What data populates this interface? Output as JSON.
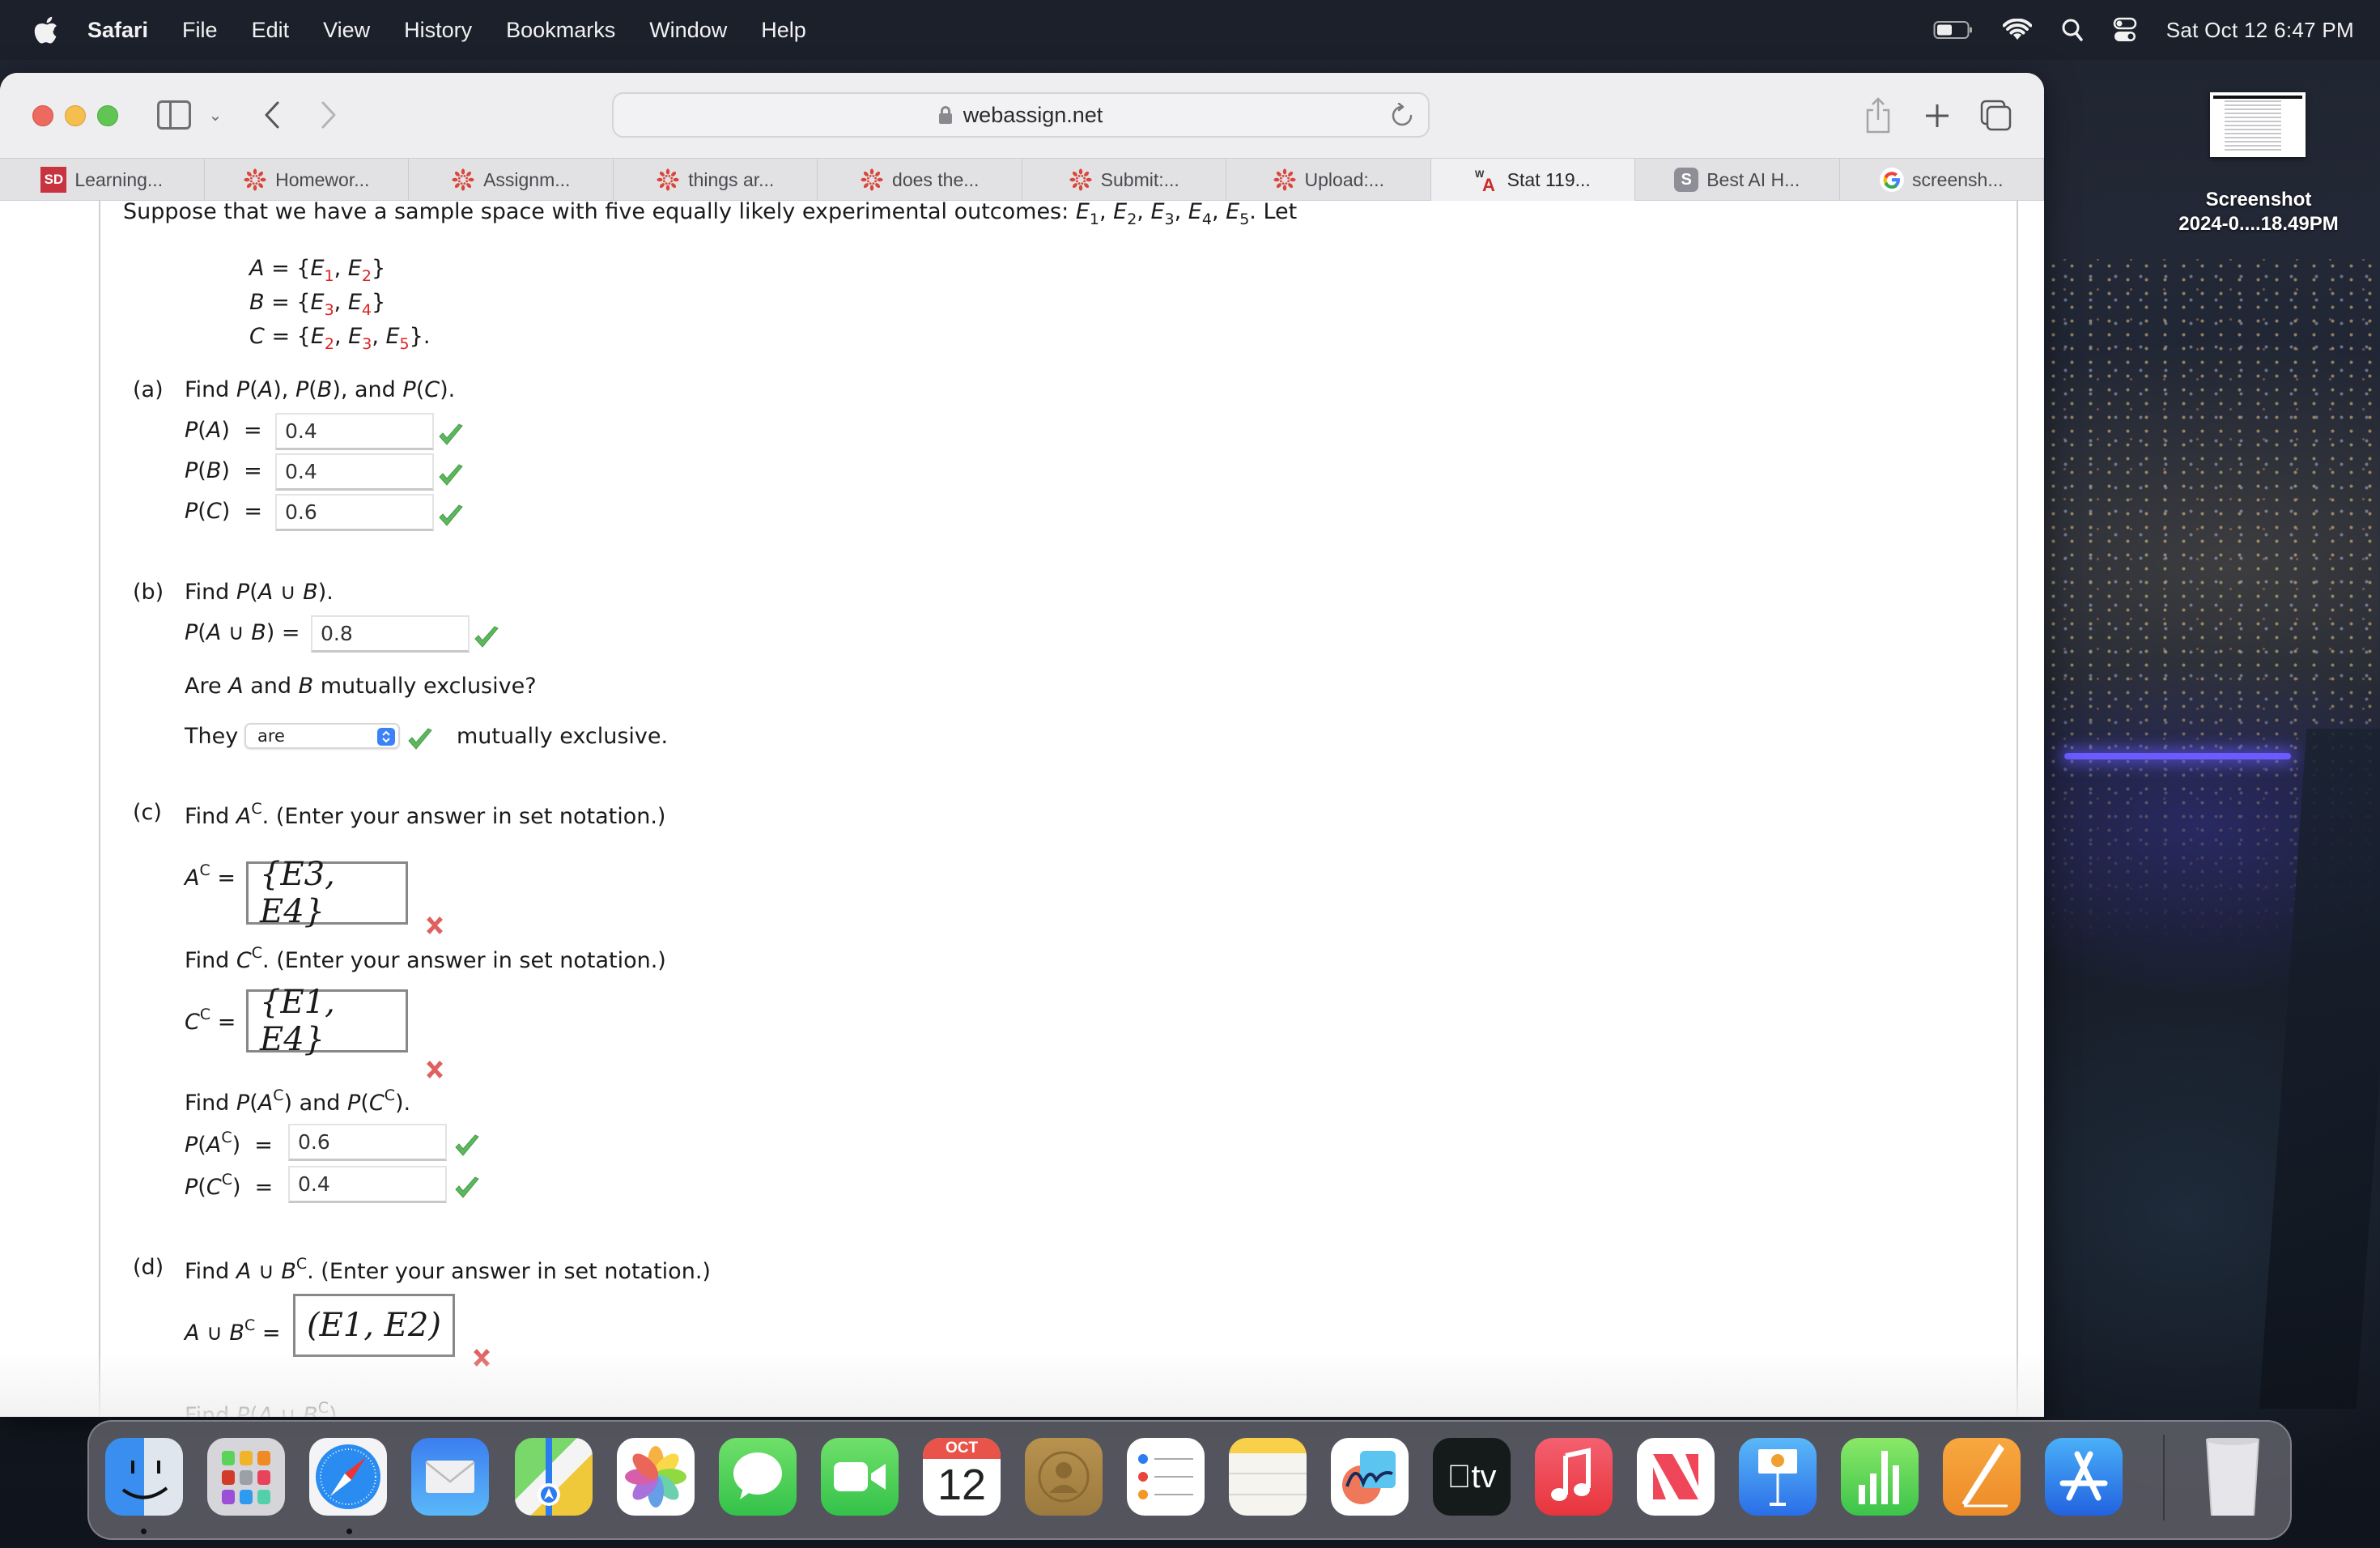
{
  "menubar": {
    "app_name": "Safari",
    "items": [
      "File",
      "Edit",
      "View",
      "History",
      "Bookmarks",
      "Window",
      "Help"
    ],
    "clock": "Sat Oct 12  6:47 PM",
    "status_icons": [
      "battery-icon",
      "wifi-icon",
      "spotlight-search-icon",
      "control-center-icon"
    ]
  },
  "browser": {
    "address": "webassign.net",
    "tabs": [
      {
        "label": "Learning...",
        "favicon": "SD",
        "active": false
      },
      {
        "label": "Homewor...",
        "favicon": "canvas",
        "active": false
      },
      {
        "label": "Assignm...",
        "favicon": "canvas",
        "active": false
      },
      {
        "label": "things ar...",
        "favicon": "canvas",
        "active": false
      },
      {
        "label": "does the...",
        "favicon": "canvas",
        "active": false
      },
      {
        "label": "Submit:...",
        "favicon": "canvas",
        "active": false
      },
      {
        "label": "Upload:...",
        "favicon": "canvas",
        "active": false
      },
      {
        "label": "Stat 119...",
        "favicon": "WA",
        "active": true
      },
      {
        "label": "Best AI H...",
        "favicon": "S",
        "active": false
      },
      {
        "label": "screensh...",
        "favicon": "G",
        "active": false
      }
    ]
  },
  "problem": {
    "intro": "Suppose that we have a sample space with five equally likely experimental outcomes: ",
    "intro_end": ". Let",
    "outcomes": [
      "1",
      "2",
      "3",
      "4",
      "5"
    ],
    "sets": [
      {
        "name": "A",
        "elements": [
          "1",
          "2"
        ],
        "end": ""
      },
      {
        "name": "B",
        "elements": [
          "3",
          "4"
        ],
        "end": ""
      },
      {
        "name": "C",
        "elements": [
          "2",
          "3",
          "5"
        ],
        "end": "."
      }
    ],
    "part_a": {
      "label": "(a)",
      "prompt": "Find P(A), P(B), and P(C).",
      "answers": [
        {
          "label": "P(A)",
          "value": "0.4",
          "status": "correct"
        },
        {
          "label": "P(B)",
          "value": "0.4",
          "status": "correct"
        },
        {
          "label": "P(C)",
          "value": "0.6",
          "status": "correct"
        }
      ]
    },
    "part_b": {
      "label": "(b)",
      "prompt": "Find P(A ∪ B).",
      "answer_label": "P(A ∪ B)",
      "answer_value": "0.8",
      "answer_status": "correct",
      "question": "Are A and B mutually exclusive?",
      "they": "They",
      "select_value": "are",
      "select_status": "correct",
      "suffix": "mutually exclusive."
    },
    "part_c": {
      "label": "(c)",
      "prompt_ac": "Find A",
      "prompt_suffix": ". (Enter your answer in set notation.)",
      "ac_label": "A",
      "ac_value": "{E3, E4}",
      "ac_status": "incorrect",
      "prompt_cc": "Find C",
      "cc_label": "C",
      "cc_value": "{E1, E4}",
      "cc_status": "incorrect",
      "prompt_probs": "Find P(A",
      "prob_answers": [
        {
          "label": "P(A",
          "value": "0.6",
          "status": "correct"
        },
        {
          "label": "P(C",
          "value": "0.4",
          "status": "correct"
        }
      ]
    },
    "part_d": {
      "label": "(d)",
      "prompt": "Find A ∪ B",
      "prompt_suffix": ". (Enter your answer in set notation.)",
      "answer_label": "A ∪ B",
      "answer_value": "(E1, E2)",
      "answer_status": "incorrect",
      "next_prompt": "Find P(A ∪ B"
    },
    "complement_sup": "C"
  },
  "desktop": {
    "file_name_line1": "Screenshot",
    "file_name_line2": "2024-0....18.49PM"
  },
  "dock": {
    "calendar_month": "OCT",
    "calendar_day": "12",
    "apps": [
      "Finder",
      "Launchpad",
      "Safari",
      "Mail",
      "Maps",
      "Photos",
      "Messages",
      "FaceTime",
      "Calendar",
      "Contacts",
      "Reminders",
      "Notes",
      "Freeform",
      "TV",
      "Music",
      "News",
      "Keynote",
      "Numbers",
      "Pages",
      "App Store",
      "Trash"
    ],
    "tv_label": "tv"
  },
  "colors": {
    "correct": "#5cb85c",
    "incorrect": "#e05555",
    "subscript_red": "#e02020",
    "select_accent": "#3a82f7"
  }
}
